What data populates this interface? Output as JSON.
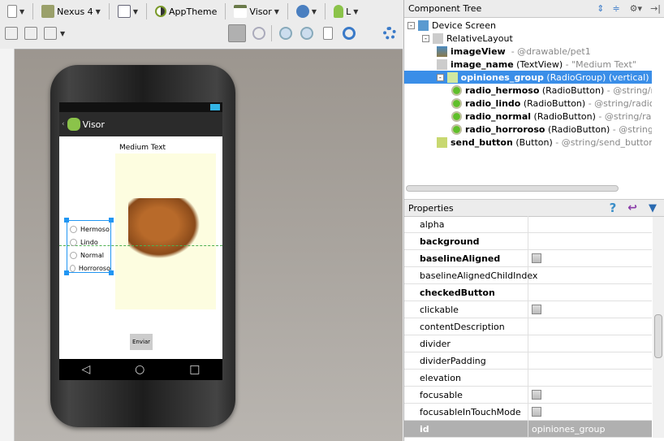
{
  "toolbar": {
    "device": "Nexus 4",
    "theme": "AppTheme",
    "activity": "Visor",
    "api": "L",
    "row1_icons": [
      "new-device-icon",
      "nexus-device-icon",
      "orientation-icon",
      "theme-icon",
      "activity-icon",
      "locale-icon",
      "android-api-icon"
    ],
    "row2_icons": [
      "fit-width-icon",
      "fit-height-icon",
      "layout-expand-icon",
      "zoom-fit-icon",
      "zoom-actual-icon",
      "zoom-in-icon",
      "zoom-out-icon",
      "preview-icon",
      "refresh-icon",
      "settings-icon"
    ]
  },
  "phone": {
    "app_title": "Visor",
    "text": "Medium Text",
    "radio_options": [
      "Hermoso",
      "Lindo",
      "Normal",
      "Horroroso"
    ],
    "button": "Enviar"
  },
  "component_tree": {
    "title": "Component Tree",
    "items": [
      {
        "name": "Device Screen",
        "type": "",
        "detail": "",
        "level": 0
      },
      {
        "name": "RelativeLayout",
        "type": "",
        "detail": "",
        "level": 1
      },
      {
        "name": "imageView",
        "type": "",
        "detail": "- @drawable/pet1",
        "level": 2
      },
      {
        "name": "image_name",
        "type": "(TextView)",
        "detail": "- \"Medium Text\"",
        "level": 2
      },
      {
        "name": "opiniones_group",
        "type": "(RadioGroup) (vertical)",
        "detail": "",
        "level": 2,
        "selected": true
      },
      {
        "name": "radio_hermoso",
        "type": "(RadioButton)",
        "detail": "- @string/rad",
        "level": 3
      },
      {
        "name": "radio_lindo",
        "type": "(RadioButton)",
        "detail": "- @string/radio_bu",
        "level": 3
      },
      {
        "name": "radio_normal",
        "type": "(RadioButton)",
        "detail": "- @string/radio_",
        "level": 3
      },
      {
        "name": "radio_horroroso",
        "type": "(RadioButton)",
        "detail": "- @string/ra",
        "level": 3
      },
      {
        "name": "send_button",
        "type": "(Button)",
        "detail": "- @string/send_button",
        "level": 2
      }
    ]
  },
  "properties": {
    "title": "Properties",
    "rows": [
      {
        "name": "alpha",
        "bold": false,
        "checkbox": false,
        "value": ""
      },
      {
        "name": "background",
        "bold": true,
        "checkbox": false,
        "value": ""
      },
      {
        "name": "baselineAligned",
        "bold": true,
        "checkbox": true,
        "value": ""
      },
      {
        "name": "baselineAlignedChildIndex",
        "bold": false,
        "checkbox": false,
        "value": ""
      },
      {
        "name": "checkedButton",
        "bold": true,
        "checkbox": false,
        "value": ""
      },
      {
        "name": "clickable",
        "bold": false,
        "checkbox": true,
        "value": ""
      },
      {
        "name": "contentDescription",
        "bold": false,
        "checkbox": false,
        "value": ""
      },
      {
        "name": "divider",
        "bold": false,
        "checkbox": false,
        "value": ""
      },
      {
        "name": "dividerPadding",
        "bold": false,
        "checkbox": false,
        "value": ""
      },
      {
        "name": "elevation",
        "bold": false,
        "checkbox": false,
        "value": ""
      },
      {
        "name": "focusable",
        "bold": false,
        "checkbox": true,
        "value": ""
      },
      {
        "name": "focusableInTouchMode",
        "bold": false,
        "checkbox": true,
        "value": ""
      },
      {
        "name": "id",
        "bold": true,
        "checkbox": false,
        "value": "opiniones_group",
        "selected": true
      }
    ]
  },
  "colors": {
    "selection": "#3a8ee8",
    "selection_handle": "#2196f3",
    "guide": "#4caf50",
    "image_bg": "#fdfde0"
  }
}
